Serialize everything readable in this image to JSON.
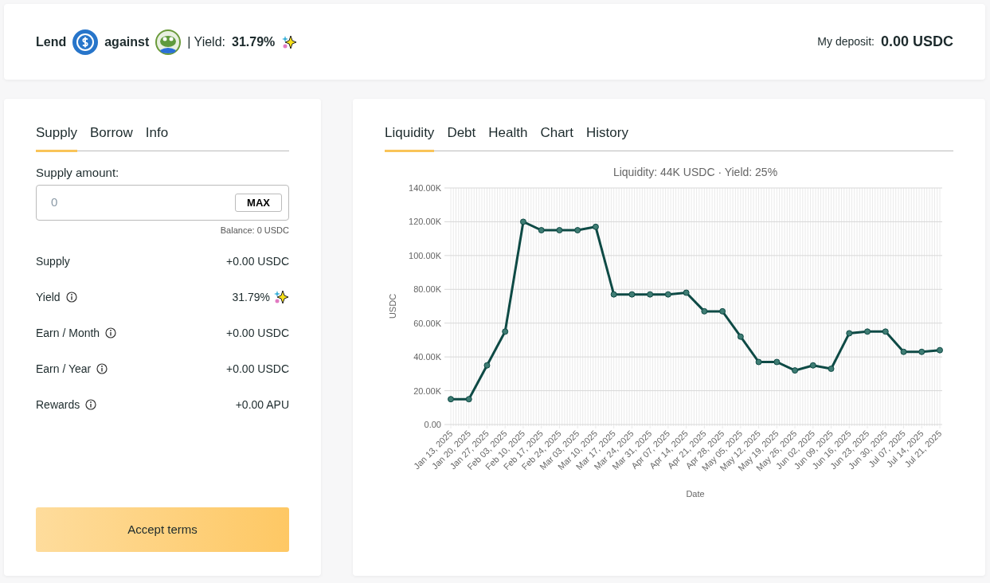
{
  "header": {
    "lend_label": "Lend",
    "against_label": "against",
    "yield_label": "| Yield:",
    "yield_value": "31.79%",
    "deposit_label": "My deposit:",
    "deposit_value": "0.00 USDC"
  },
  "left_tabs": [
    {
      "label": "Supply",
      "selected": true
    },
    {
      "label": "Borrow",
      "selected": false
    },
    {
      "label": "Info",
      "selected": false
    }
  ],
  "supply_amount": {
    "label": "Supply amount:",
    "placeholder": "0",
    "max_button": "MAX",
    "balance": "Balance: 0 USDC"
  },
  "stats": [
    {
      "label": "Supply",
      "value": "+0.00 USDC",
      "info": false,
      "sparkle": false
    },
    {
      "label": "Yield",
      "value": "31.79%",
      "info": true,
      "sparkle": true
    },
    {
      "label": "Earn / Month",
      "value": "+0.00 USDC",
      "info": true,
      "sparkle": false
    },
    {
      "label": "Earn / Year",
      "value": "+0.00 USDC",
      "info": true,
      "sparkle": false
    },
    {
      "label": "Rewards",
      "value": "+0.00 APU",
      "info": true,
      "sparkle": false
    }
  ],
  "accept_button": "Accept terms",
  "right_tabs": [
    {
      "label": "Liquidity",
      "selected": true
    },
    {
      "label": "Debt",
      "selected": false
    },
    {
      "label": "Health",
      "selected": false
    },
    {
      "label": "Chart",
      "selected": false
    },
    {
      "label": "History",
      "selected": false
    }
  ],
  "chart_data": {
    "type": "line",
    "title": "Liquidity: 44K USDC · Yield: 25%",
    "xlabel": "Date",
    "ylabel": "USDC",
    "ylim": [
      0,
      140000
    ],
    "grid": true,
    "yticks": [
      {
        "value": 0,
        "label": "0.00"
      },
      {
        "value": 20000,
        "label": "20.00K"
      },
      {
        "value": 40000,
        "label": "40.00K"
      },
      {
        "value": 60000,
        "label": "60.00K"
      },
      {
        "value": 80000,
        "label": "80.00K"
      },
      {
        "value": 100000,
        "label": "100.00K"
      },
      {
        "value": 120000,
        "label": "120.00K"
      },
      {
        "value": 140000,
        "label": "140.00K"
      }
    ],
    "categories": [
      "Jan 13, 2025",
      "Jan 20, 2025",
      "Jan 27, 2025",
      "Feb 03, 2025",
      "Feb 10, 2025",
      "Feb 17, 2025",
      "Feb 24, 2025",
      "Mar 03, 2025",
      "Mar 10, 2025",
      "Mar 17, 2025",
      "Mar 24, 2025",
      "Mar 31, 2025",
      "Apr 07, 2025",
      "Apr 14, 2025",
      "Apr 21, 2025",
      "Apr 28, 2025",
      "May 05, 2025",
      "May 12, 2025",
      "May 19, 2025",
      "May 26, 2025",
      "Jun 02, 2025",
      "Jun 09, 2025",
      "Jun 16, 2025",
      "Jun 23, 2025",
      "Jun 30, 2025",
      "Jul 07, 2025",
      "Jul 14, 2025",
      "Jul 21, 2025"
    ],
    "series": [
      {
        "color": "#0e4a45",
        "marker": true,
        "values": [
          15000,
          15000,
          35000,
          55000,
          120000,
          115000,
          115000,
          115000,
          117000,
          77000,
          77000,
          77000,
          77000,
          78000,
          67000,
          67000,
          52000,
          37000,
          37000,
          32000,
          35000,
          33000,
          54000,
          55000,
          55000,
          43000,
          43000,
          44000
        ]
      }
    ]
  }
}
